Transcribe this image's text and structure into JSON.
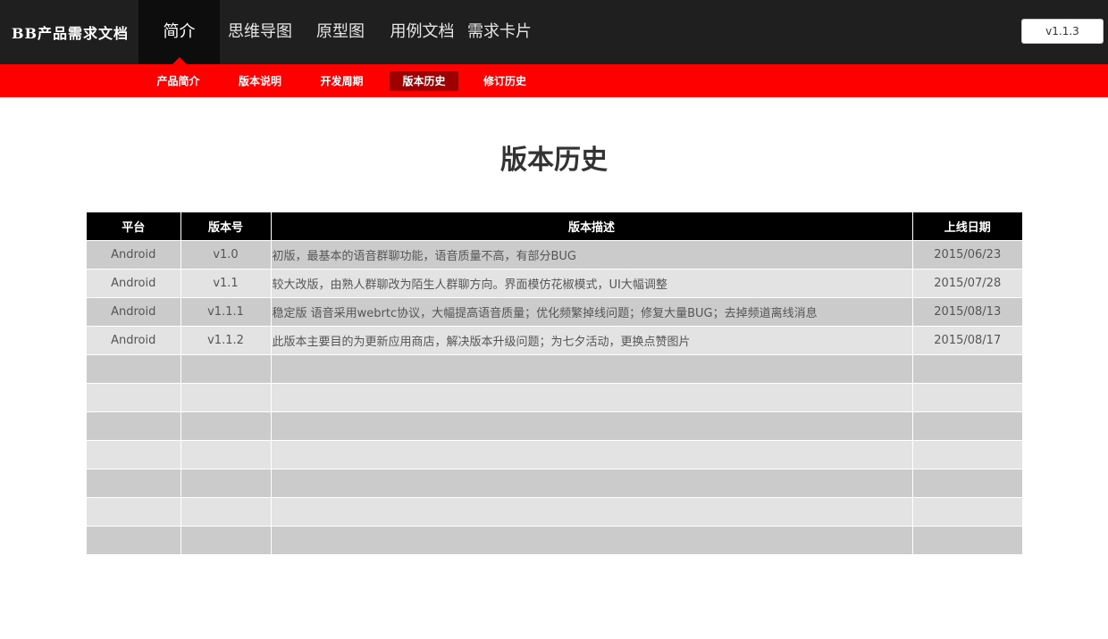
{
  "header": {
    "brand": "BB产品需求文档",
    "nav": [
      {
        "label": "简介",
        "active": true
      },
      {
        "label": "思维导图",
        "active": false
      },
      {
        "label": "原型图",
        "active": false
      },
      {
        "label": "用例文档",
        "active": false
      },
      {
        "label": "需求卡片",
        "active": false
      }
    ],
    "version_button": "v1.1.3"
  },
  "subnav": [
    {
      "label": "产品简介",
      "active": false
    },
    {
      "label": "版本说明",
      "active": false
    },
    {
      "label": "开发周期",
      "active": false
    },
    {
      "label": "版本历史",
      "active": true
    },
    {
      "label": "修订历史",
      "active": false
    }
  ],
  "page": {
    "title": "版本历史"
  },
  "table": {
    "columns": [
      "平台",
      "版本号",
      "版本描述",
      "上线日期"
    ],
    "rows": [
      [
        "Android",
        "v1.0",
        "初版，最基本的语音群聊功能，语音质量不高，有部分BUG",
        "2015/06/23"
      ],
      [
        "Android",
        "v1.1",
        "较大改版，由熟人群聊改为陌生人群聊方向。界面模仿花椒模式，UI大幅调整",
        "2015/07/28"
      ],
      [
        "Android",
        "v1.1.1",
        "稳定版 语音采用webrtc协议，大幅提高语音质量；优化频繁掉线问题；修复大量BUG；去掉频道离线消息",
        "2015/08/13"
      ],
      [
        "Android",
        "v1.1.2",
        "此版本主要目的为更新应用商店，解决版本升级问题；为七夕活动，更换点赞图片",
        "2015/08/17"
      ],
      [
        "",
        "",
        "",
        ""
      ],
      [
        "",
        "",
        "",
        ""
      ],
      [
        "",
        "",
        "",
        ""
      ],
      [
        "",
        "",
        "",
        ""
      ],
      [
        "",
        "",
        "",
        ""
      ],
      [
        "",
        "",
        "",
        ""
      ],
      [
        "",
        "",
        "",
        ""
      ]
    ]
  },
  "colors": {
    "topbar": "#1f1f1f",
    "accent": "#ff0000",
    "active_sub": "#9e0000",
    "table_header": "#000000",
    "row_odd": "#cbcbcb",
    "row_even": "#e3e3e3"
  }
}
